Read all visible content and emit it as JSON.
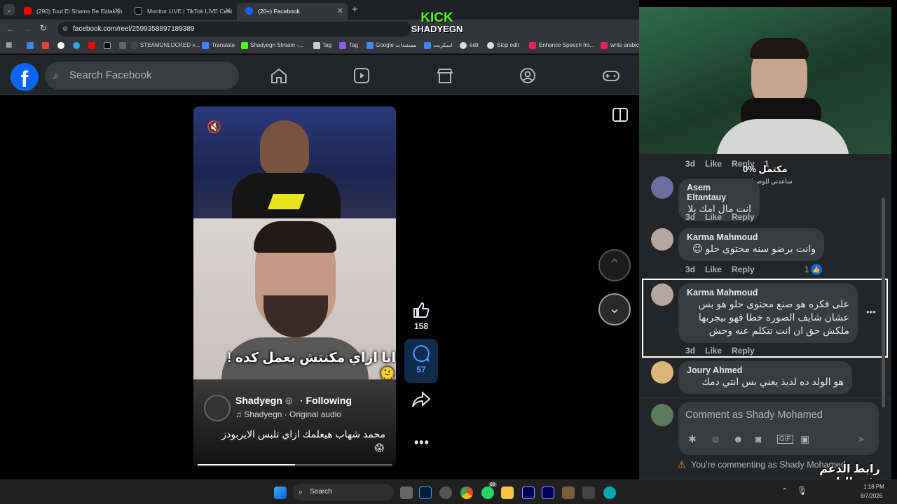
{
  "browser": {
    "tabs": [
      {
        "title": "(290) Toul El Shams Be Eidak (h",
        "favicon_color": "#ff0000",
        "active": false
      },
      {
        "title": "Monitor LIVE | TikTok LIVE Cent",
        "favicon_color": "#ffffff",
        "active": false
      },
      {
        "title": "(20+) Facebook",
        "favicon_color": "#0866ff",
        "active": true
      }
    ],
    "url": "facebook.com/reel/2599358897189389",
    "bookmarks": [
      "STEAMUNLOCKED »...",
      "Translate",
      "Shadyegn Stream -...",
      "Tag",
      "Tag",
      "Google مستندات",
      "اسكربت",
      "edit",
      "Stop edit",
      "Enhance Speech fro...",
      "write arabic"
    ]
  },
  "overlay": {
    "kick_brand": "KICK",
    "kick_name": "SHADYEGN",
    "watermark_l1": "رابط الدعم",
    "watermark_l2": "في البايو"
  },
  "facebook": {
    "search_placeholder": "Search Facebook",
    "reel": {
      "caption_overlay": "انا ازاي مكنتش بعمل كده ! 🫠",
      "author": "Shadyegn",
      "following": "· Following",
      "audio": "♫ Shadyegn · Original audio",
      "description": "محمد شهاب هيعلمك ازاي تلبس الايربودز",
      "description_emoji": "😱"
    },
    "actions": {
      "likes": "158",
      "comments": "57"
    }
  },
  "comments_panel": {
    "top_meta": {
      "time": "3d",
      "like": "Like",
      "reply": "Reply",
      "count": "1"
    },
    "goal_text": "0% مكتمل",
    "goal_sub": "ساعدني للوصول للهدف",
    "comments": [
      {
        "name": "Asem Eltantauy",
        "text": "انت مال امك يلا",
        "time": "3d",
        "like": "Like",
        "reply": "Reply",
        "reactions": ""
      },
      {
        "name": "Karma Mahmoud",
        "text": "وانت برضو سنه محتوى حلو 😉",
        "time": "3d",
        "like": "Like",
        "reply": "Reply",
        "reactions": "1"
      },
      {
        "name": "Karma Mahmoud",
        "text": "على فكره هو صنع محتوى حلو هو بس عشان شايف الصوره خطا فهو بيجربها ملكش حق ان انت تتكلم عنه وحش",
        "time": "3d",
        "like": "Like",
        "reply": "Reply",
        "reactions": ""
      },
      {
        "name": "Joury Ahmed",
        "text": "هو الولد ده لذيذ يعني بس انتي دمك",
        "time": "",
        "like": "",
        "reply": "",
        "reactions": ""
      }
    ],
    "composer_placeholder": "Comment as Shady Mohamed",
    "warning": "You're commenting as Shady Mohamed"
  },
  "taskbar": {
    "search": "Search",
    "badge": "99",
    "time": "1:18 PM",
    "date": "8/7/2026"
  }
}
